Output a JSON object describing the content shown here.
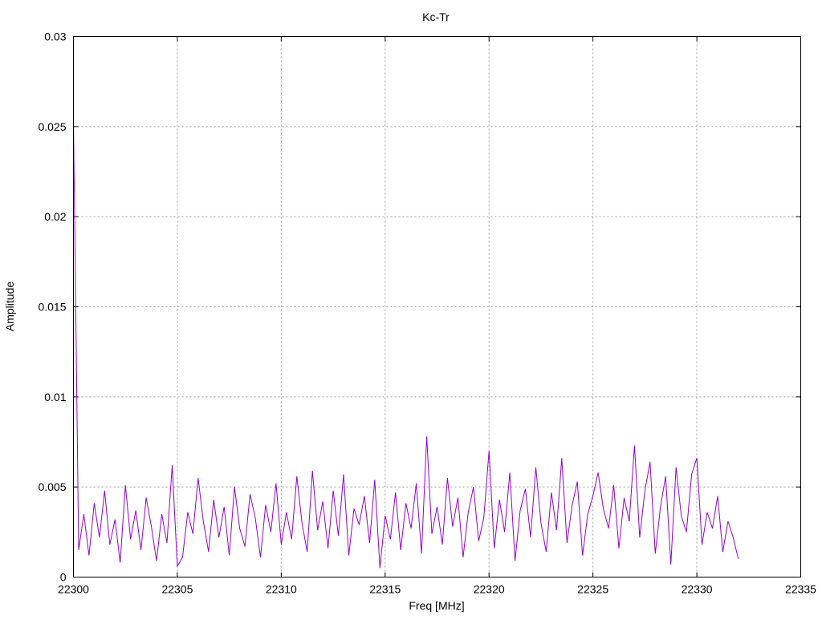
{
  "chart_data": {
    "type": "line",
    "title": "Kc-Tr",
    "xlabel": "Freq [MHz]",
    "ylabel": "Amplitude",
    "xlim": [
      22300,
      22335
    ],
    "ylim": [
      0,
      0.03
    ],
    "xticks": [
      "22300",
      "22305",
      "22310",
      "22315",
      "22320",
      "22325",
      "22330",
      "22335"
    ],
    "yticks": [
      "0",
      "0.005",
      "0.01",
      "0.015",
      "0.02",
      "0.025",
      "0.03"
    ],
    "grid": true,
    "series": [
      {
        "name": "Kc-Tr",
        "color": "#9400d3",
        "x_start": 22300,
        "x_step": 0.25,
        "values": [
          0.0254,
          0.0015,
          0.0035,
          0.0012,
          0.0041,
          0.0022,
          0.0048,
          0.0018,
          0.0032,
          0.0008,
          0.0051,
          0.0021,
          0.0037,
          0.0015,
          0.0044,
          0.0028,
          0.0009,
          0.0035,
          0.0019,
          0.0062,
          0.0006,
          0.0011,
          0.0036,
          0.0024,
          0.0055,
          0.0031,
          0.0014,
          0.0043,
          0.0022,
          0.0039,
          0.0012,
          0.005,
          0.0027,
          0.0017,
          0.0046,
          0.0033,
          0.0011,
          0.004,
          0.0025,
          0.0052,
          0.0018,
          0.0036,
          0.0021,
          0.0056,
          0.003,
          0.0014,
          0.0059,
          0.0026,
          0.0042,
          0.0016,
          0.0048,
          0.0023,
          0.0057,
          0.0012,
          0.0038,
          0.0029,
          0.0045,
          0.0019,
          0.0054,
          0.0005,
          0.0034,
          0.0021,
          0.0047,
          0.0015,
          0.0041,
          0.0027,
          0.0052,
          0.0013,
          0.0078,
          0.0024,
          0.0039,
          0.0018,
          0.0055,
          0.0028,
          0.0044,
          0.0011,
          0.0036,
          0.005,
          0.002,
          0.0033,
          0.007,
          0.0016,
          0.0043,
          0.0025,
          0.0058,
          0.0009,
          0.0037,
          0.0049,
          0.0022,
          0.0061,
          0.003,
          0.0014,
          0.0047,
          0.0026,
          0.0066,
          0.0019,
          0.004,
          0.0053,
          0.0012,
          0.0035,
          0.0045,
          0.0058,
          0.0038,
          0.0027,
          0.0051,
          0.0016,
          0.0044,
          0.0031,
          0.0073,
          0.0022,
          0.0048,
          0.0064,
          0.0013,
          0.0039,
          0.0056,
          0.0007,
          0.0061,
          0.0034,
          0.0025,
          0.0057,
          0.0066,
          0.0018,
          0.0036,
          0.0027,
          0.0045,
          0.0014,
          0.0031,
          0.0022,
          0.001
        ]
      }
    ]
  }
}
